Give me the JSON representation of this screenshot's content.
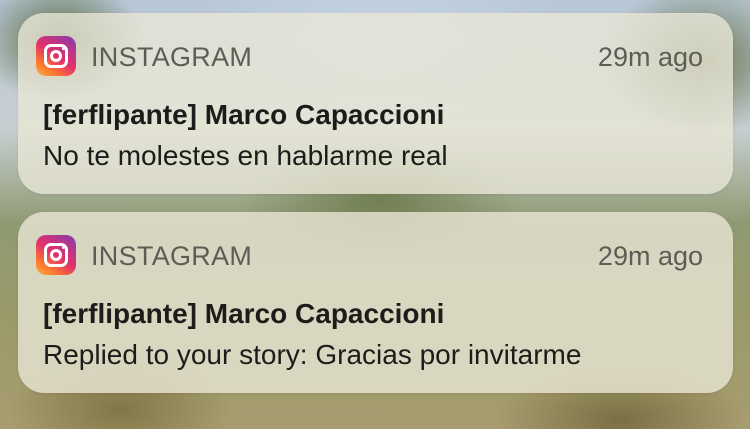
{
  "notifications": [
    {
      "app_name": "INSTAGRAM",
      "app_icon": "instagram-icon",
      "time": "29m ago",
      "title": "[ferflipante] Marco Capaccioni",
      "message": "No te molestes en hablarme real"
    },
    {
      "app_name": "INSTAGRAM",
      "app_icon": "instagram-icon",
      "time": "29m ago",
      "title": "[ferflipante] Marco Capaccioni",
      "message": "Replied to your story: Gracias por invitarme"
    }
  ],
  "colors": {
    "card_background": "#e8e6d6",
    "secondary_text": "#5d5d55",
    "primary_text": "#1c1c1a"
  }
}
